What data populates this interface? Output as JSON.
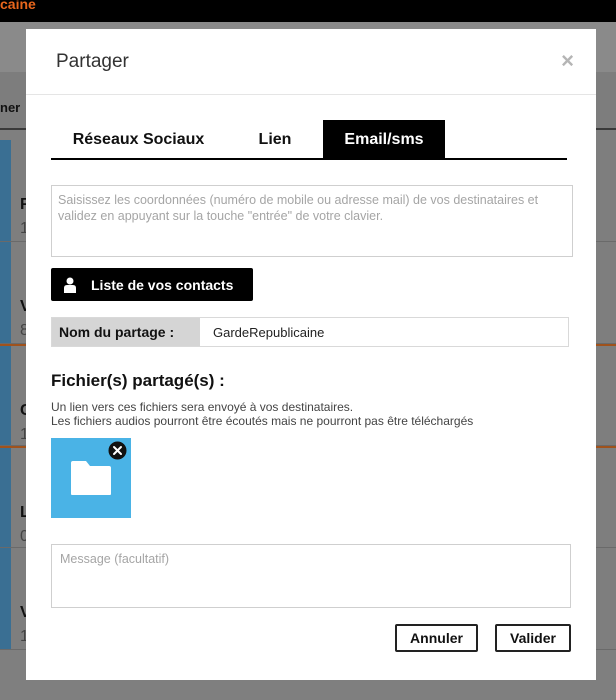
{
  "background": {
    "brand_fragment": "caine",
    "toolbar_fragment": "ner",
    "rows": [
      {
        "title": "F",
        "sub": "1"
      },
      {
        "title": "V",
        "sub": "8"
      },
      {
        "title": "C",
        "sub": "1"
      },
      {
        "title": "L",
        "sub": "0"
      },
      {
        "title": "V",
        "sub": "1"
      }
    ]
  },
  "modal": {
    "title": "Partager",
    "close": "×",
    "tabs": [
      {
        "label": "Réseaux Sociaux",
        "active": false
      },
      {
        "label": "Lien",
        "active": false
      },
      {
        "label": "Email/sms",
        "active": true
      }
    ],
    "recipients_placeholder": "Saisissez les coordonnées (numéro de mobile ou adresse mail) de vos destinataires et validez en appuyant sur la touche \"entrée\" de votre clavier.",
    "contacts_button": "Liste de vos contacts",
    "share_name_label": "Nom du partage :",
    "share_name_value": "GardeRepublicaine",
    "files_title": "Fichier(s) partagé(s) :",
    "files_desc_line1": "Un lien vers ces fichiers sera envoyé à vos destinataires.",
    "files_desc_line2": "Les fichiers audios pourront être écoutés mais ne pourront pas être téléchargés",
    "file_icon": "folder-icon",
    "message_placeholder": "Message (facultatif)",
    "cancel_label": "Annuler",
    "ok_label": "Valider"
  },
  "colors": {
    "accent": "#e8661c",
    "tile": "#4ab3e6",
    "active_tab": "#000000"
  }
}
